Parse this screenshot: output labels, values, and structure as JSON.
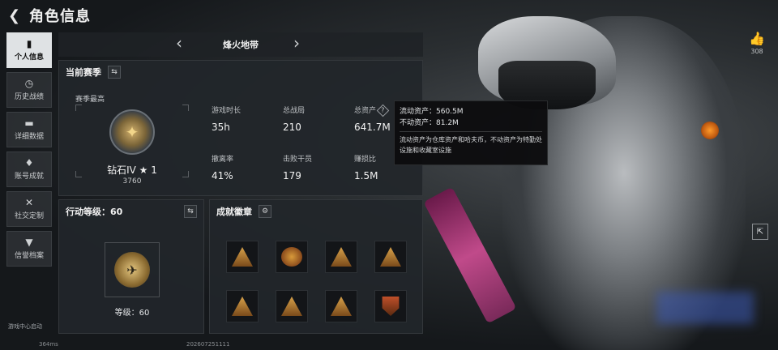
{
  "header": {
    "title": "角色信息"
  },
  "sidebar": {
    "items": [
      {
        "label": "个人信息",
        "icon": "bar-chart-icon",
        "glyph": "▮",
        "active": true
      },
      {
        "label": "历史战绩",
        "icon": "history-icon",
        "glyph": "◷",
        "active": false
      },
      {
        "label": "详细数据",
        "icon": "folder-icon",
        "glyph": "▬",
        "active": false
      },
      {
        "label": "账号成就",
        "icon": "achievement-icon",
        "glyph": "♦",
        "active": false
      },
      {
        "label": "社交定制",
        "icon": "tools-icon",
        "glyph": "✕",
        "active": false
      },
      {
        "label": "信誉档案",
        "icon": "shield-icon",
        "glyph": "▼",
        "active": false
      }
    ],
    "bottom_tag": "游戏中心启动"
  },
  "mode": {
    "name": "烽火地带",
    "prev_glyph": "‹",
    "next_glyph": "›"
  },
  "season": {
    "title": "当前赛季",
    "peak_label": "赛季最高",
    "rank_name": "钻石IV ★ 1",
    "rank_score": "3760",
    "stats": [
      {
        "label": "游戏时长",
        "value": "35h"
      },
      {
        "label": "总战局",
        "value": "210"
      },
      {
        "label": "总资产",
        "value": "641.7M"
      },
      {
        "label": "撤离率",
        "value": "41%"
      },
      {
        "label": "击败干员",
        "value": "179"
      },
      {
        "label": "赚损比",
        "value": "1.5M"
      }
    ]
  },
  "tooltip": {
    "liquid": "流动资产：560.5M",
    "fixed": "不动资产：81.2M",
    "desc": "流动资产为仓库资产和哈夫币，不动资产为特勤处设施和收藏室设施"
  },
  "level": {
    "title": "行动等级：60",
    "level_text": "等级：60"
  },
  "badges": {
    "title": "成就徽章",
    "items": [
      {
        "icon": "badge-triangle-icon",
        "shape": "tri"
      },
      {
        "icon": "badge-round-icon",
        "shape": "round"
      },
      {
        "icon": "badge-triangle-icon",
        "shape": "tri"
      },
      {
        "icon": "badge-triangle-icon",
        "shape": "tri"
      },
      {
        "icon": "badge-triangle-icon",
        "shape": "tri"
      },
      {
        "icon": "badge-triangle-icon",
        "shape": "tri"
      },
      {
        "icon": "badge-triangle-icon",
        "shape": "tri"
      },
      {
        "icon": "badge-shield-icon",
        "shape": "shield"
      }
    ]
  },
  "like": {
    "count": "308"
  },
  "footer": {
    "latency": "364ms",
    "uid": "202607251111"
  },
  "colors": {
    "active_tab": "#dfe2e4",
    "panel": "#22262a",
    "badge_gold": "#d8a24a"
  }
}
